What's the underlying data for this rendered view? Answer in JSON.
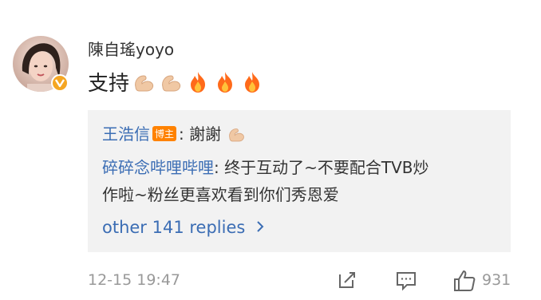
{
  "comment": {
    "username": "陳自瑤yoyo",
    "text": "支持",
    "emojis": [
      "muscle",
      "muscle",
      "fire",
      "fire",
      "fire"
    ],
    "verified_color": "#f5a623"
  },
  "replies": [
    {
      "name": "王浩信",
      "badge": "博主",
      "text": ": 謝謝",
      "emoji": "muscle"
    },
    {
      "name": "碎碎念哔哩哔哩",
      "text_line1": ": 终于互动了~不要配合TVB炒",
      "text_line2": "作啦~粉丝更喜欢看到你们秀恩爱"
    }
  ],
  "more_replies": "other 141 replies",
  "footer": {
    "timestamp": "12-15 19:47",
    "likes": "931"
  },
  "colors": {
    "link": "#3b6db4",
    "reply_bg": "#f2f2f2",
    "badge": "#ff8200"
  }
}
